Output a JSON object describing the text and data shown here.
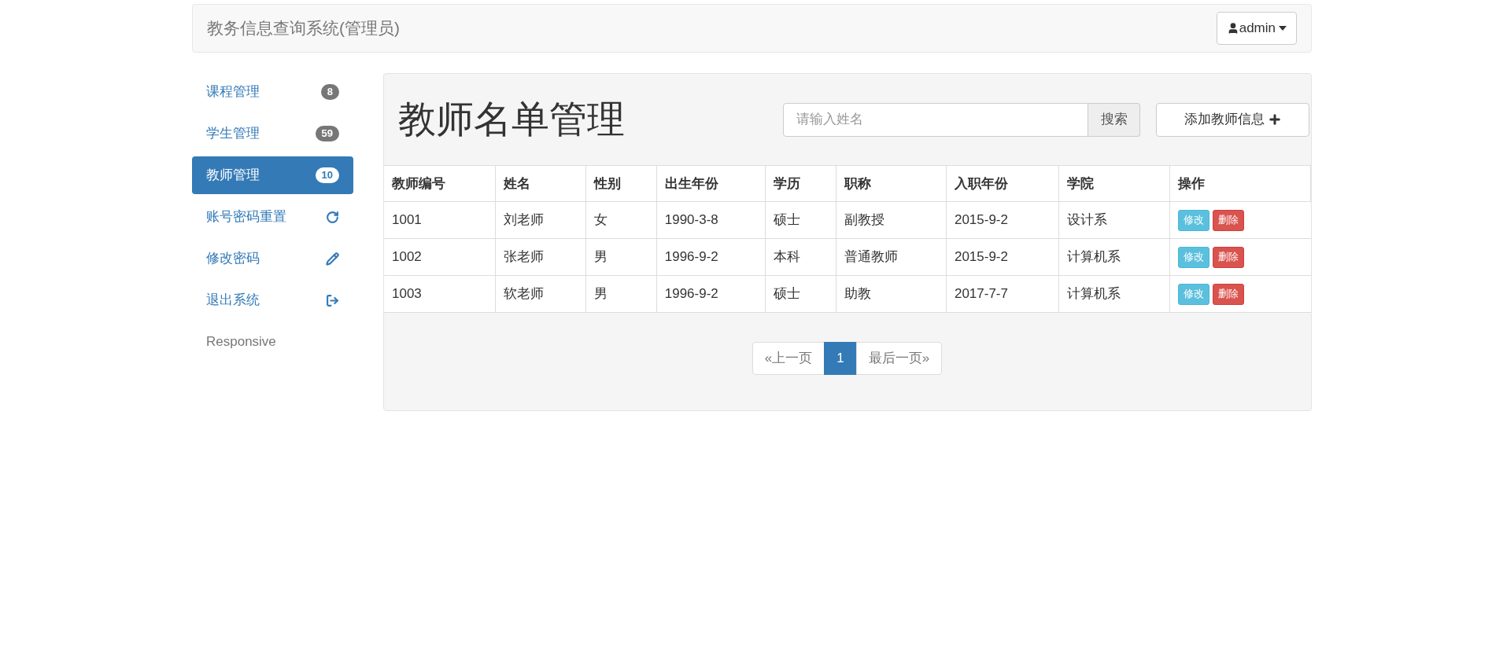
{
  "navbar": {
    "brand": "教务信息查询系统(管理员)",
    "user_menu": "admin"
  },
  "sidebar": {
    "items": [
      {
        "label": "课程管理",
        "kind": "badge",
        "badge": "8",
        "selected": false
      },
      {
        "label": "学生管理",
        "kind": "badge",
        "badge": "59",
        "selected": false
      },
      {
        "label": "教师管理",
        "kind": "badge",
        "badge": "10",
        "selected": true
      },
      {
        "label": "账号密码重置",
        "kind": "refresh",
        "selected": false
      },
      {
        "label": "修改密码",
        "kind": "pencil",
        "selected": false
      },
      {
        "label": "退出系统",
        "kind": "logout",
        "selected": false
      },
      {
        "label": "Responsive",
        "kind": "plain",
        "selected": false
      }
    ]
  },
  "main": {
    "title": "教师名单管理",
    "search": {
      "placeholder": "请输入姓名",
      "button": "搜索"
    },
    "add_button": "添加教师信息",
    "table": {
      "columns": [
        "教师编号",
        "姓名",
        "性别",
        "出生年份",
        "学历",
        "职称",
        "入职年份",
        "学院",
        "操作"
      ],
      "rows": [
        {
          "cells": [
            "1001",
            "刘老师",
            "女",
            "1990-3-8",
            "硕士",
            "副教授",
            "2015-9-2",
            "设计系"
          ],
          "actions": [
            "修改",
            "删除"
          ]
        },
        {
          "cells": [
            "1002",
            "张老师",
            "男",
            "1996-9-2",
            "本科",
            "普通教师",
            "2015-9-2",
            "计算机系"
          ],
          "actions": [
            "修改",
            "删除"
          ]
        },
        {
          "cells": [
            "1003",
            "软老师",
            "男",
            "1996-9-2",
            "硕士",
            "助教",
            "2017-7-7",
            "计算机系"
          ],
          "actions": [
            "修改",
            "删除"
          ]
        }
      ]
    },
    "pagination": [
      {
        "label": "«上一页",
        "selected": false
      },
      {
        "label": "1",
        "selected": true
      },
      {
        "label": "最后一页»",
        "selected": false
      }
    ]
  }
}
